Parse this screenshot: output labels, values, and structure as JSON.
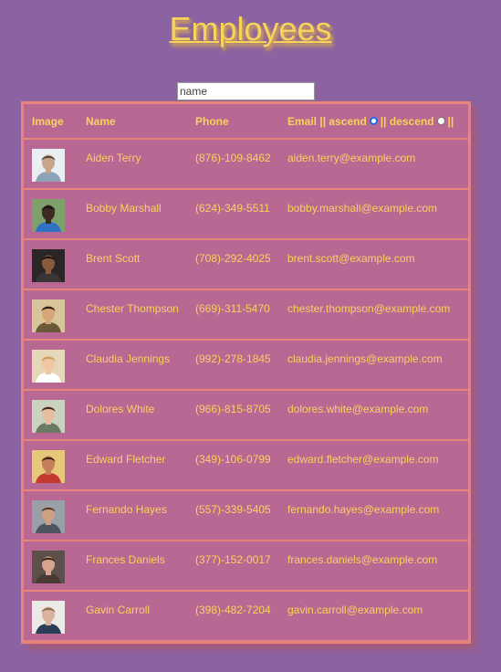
{
  "page_title": "Employees",
  "search": {
    "placeholder": "name",
    "value": ""
  },
  "table": {
    "headers": {
      "image": "Image",
      "name": "Name",
      "phone": "Phone",
      "email": "Email",
      "sep1": "||",
      "ascend": "ascend",
      "sep2": "||",
      "descend": "descend",
      "sep3": "||"
    },
    "sort": "ascend",
    "rows": [
      {
        "name": "Aiden Terry",
        "phone": "(876)-109-8462",
        "email": "aiden.terry@example.com",
        "avatar": {
          "bg": "#e9eef2",
          "skin": "#c9a48c",
          "hair": "#5b4636",
          "shirt": "#8aa3b8"
        }
      },
      {
        "name": "Bobby Marshall",
        "phone": "(624)-349-5511",
        "email": "bobby.marshall@example.com",
        "avatar": {
          "bg": "#7ea06a",
          "skin": "#3d2a20",
          "hair": "#1b1410",
          "shirt": "#2f72c4"
        }
      },
      {
        "name": "Brent Scott",
        "phone": "(708)-292-4025",
        "email": "brent.scott@example.com",
        "avatar": {
          "bg": "#2a2626",
          "skin": "#8a5a3c",
          "hair": "#1a1412",
          "shirt": "#3a3434"
        }
      },
      {
        "name": "Chester Thompson",
        "phone": "(669)-311-5470",
        "email": "chester.thompson@example.com",
        "avatar": {
          "bg": "#d8c59a",
          "skin": "#d6a57a",
          "hair": "#2a1e17",
          "shirt": "#6b5a3a"
        }
      },
      {
        "name": "Claudia Jennings",
        "phone": "(992)-278-1845",
        "email": "claudia.jennings@example.com",
        "avatar": {
          "bg": "#e6d7b8",
          "skin": "#f0c7a4",
          "hair": "#c79c54",
          "shirt": "#ffffff"
        }
      },
      {
        "name": "Dolores White",
        "phone": "(966)-815-8705",
        "email": "dolores.white@example.com",
        "avatar": {
          "bg": "#c9d3c0",
          "skin": "#e8bea0",
          "hair": "#3e2a20",
          "shirt": "#6d7a63"
        }
      },
      {
        "name": "Edward Fletcher",
        "phone": "(349)-106-0799",
        "email": "edward.fletcher@example.com",
        "avatar": {
          "bg": "#e6c87a",
          "skin": "#c47e5a",
          "hair": "#3b2618",
          "shirt": "#c53a2f"
        }
      },
      {
        "name": "Fernando Hayes",
        "phone": "(557)-339-5405",
        "email": "fernando.hayes@example.com",
        "avatar": {
          "bg": "#9aa0a8",
          "skin": "#cf9f84",
          "hair": "#4a3a32",
          "shirt": "#4d5560"
        }
      },
      {
        "name": "Frances Daniels",
        "phone": "(377)-152-0017",
        "email": "frances.daniels@example.com",
        "avatar": {
          "bg": "#5d504a",
          "skin": "#d7a58e",
          "hair": "#3a241b",
          "shirt": "#4a3a36"
        }
      },
      {
        "name": "Gavin Carroll",
        "phone": "(398)-482-7204",
        "email": "gavin.carroll@example.com",
        "avatar": {
          "bg": "#eceae6",
          "skin": "#d9b39a",
          "hair": "#8a6a4e",
          "shirt": "#2c3e57"
        }
      }
    ]
  }
}
